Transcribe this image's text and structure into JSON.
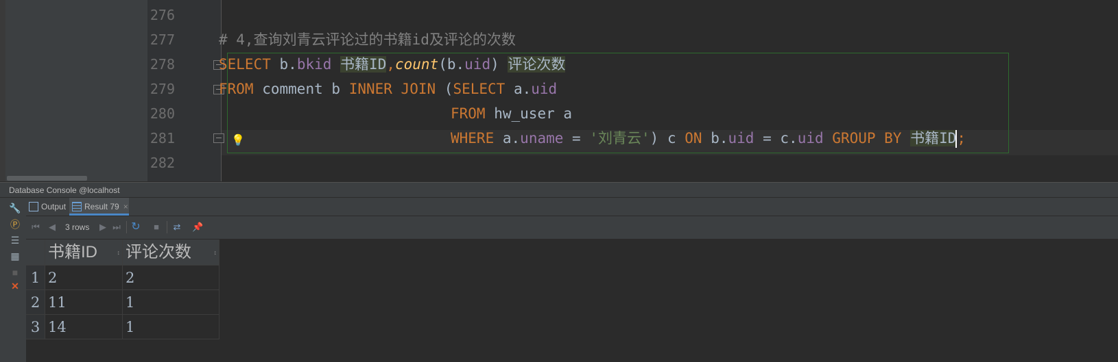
{
  "editor": {
    "lines": [
      {
        "number": "276"
      },
      {
        "number": "277",
        "comment": "# 4,查询刘青云评论过的书籍id及评论的次数"
      },
      {
        "number": "278"
      },
      {
        "number": "279"
      },
      {
        "number": "280"
      },
      {
        "number": "281"
      },
      {
        "number": "282"
      }
    ],
    "tokens": {
      "select": "SELECT",
      "b_dot_1": "b.",
      "bkid": "bkid",
      "alias_book_id": "书籍ID",
      "comma": ",",
      "count": "count",
      "paren_b": "(b.",
      "uid": "uid",
      "close_paren": ")",
      "alias_count": "评论次数",
      "from": "FROM",
      "comment_tbl": "comment b",
      "inner_join": "INNER JOIN",
      "open_paren": "(",
      "select2": "SELECT",
      "a_dot": "a.",
      "uid2": "uid",
      "from2": "FROM",
      "hw_user": "hw_user a",
      "where": "WHERE",
      "a_dot2": "a.",
      "uname": "uname",
      "eq": "=",
      "str_val": "'刘青云'",
      "close_c": ") c",
      "on": "ON",
      "b_dot2": "b.",
      "uid3": "uid",
      "eq2": "=",
      "c_dot": "c.",
      "uid4": "uid",
      "group_by": "GROUP BY",
      "alias_book_id2": "书籍ID",
      "semicolon": ";"
    }
  },
  "console": {
    "title": "Database Console @localhost",
    "tabs": [
      {
        "label": "Output"
      },
      {
        "label": "Result 79",
        "close": "×"
      }
    ],
    "rows_label": "3 rows",
    "columns": [
      "书籍ID",
      "评论次数"
    ],
    "rows": [
      {
        "num": "1",
        "values": [
          "2",
          "2"
        ]
      },
      {
        "num": "2",
        "values": [
          "11",
          "1"
        ]
      },
      {
        "num": "3",
        "values": [
          "14",
          "1"
        ]
      }
    ],
    "colors": {
      "accent": "#4a88c7",
      "keyword": "#cc7832",
      "field": "#9876aa",
      "string": "#6a8759"
    }
  }
}
